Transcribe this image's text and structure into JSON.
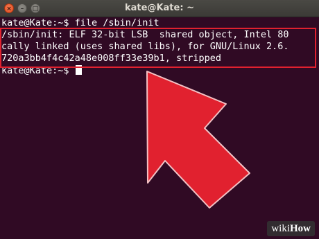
{
  "window": {
    "title": "kate@Kate: ~",
    "close_icon": "×",
    "minimize_icon": "–",
    "maximize_icon": "□"
  },
  "terminal": {
    "lines": [
      "kate@Kate:~$ file /sbin/init",
      "/sbin/init: ELF 32-bit LSB  shared object, Intel 80",
      "cally linked (uses shared libs), for GNU/Linux 2.6.",
      "720a3bb4f4c42a48e008ff33e39b1, stripped",
      "kate@Kate:~$ "
    ]
  },
  "watermark": {
    "part1": "wiki",
    "part2": "How"
  },
  "colors": {
    "terminal_bg": "#300a24",
    "highlight": "#e1212f",
    "arrow": "#e1212f"
  }
}
